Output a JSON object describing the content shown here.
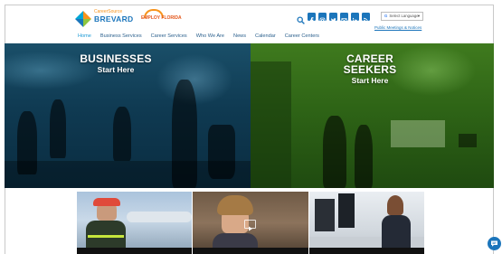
{
  "brand": {
    "logo_top": "CareerSource",
    "logo_name": "BREVARD",
    "partner_logo_text": "EMPLOY FLORIDA"
  },
  "header": {
    "social_icons": [
      "search-icon",
      "facebook-icon",
      "instagram-icon",
      "twitter-icon",
      "email-icon",
      "linkedin-icon",
      "rss-icon"
    ],
    "language_label": "Select Language",
    "public_link": "Public Meetings & Notices"
  },
  "nav": {
    "items": [
      "Home",
      "Business Services",
      "Career Services",
      "Who We Are",
      "News",
      "Calendar",
      "Career Centers"
    ],
    "active": "Home"
  },
  "hero": {
    "left_title": "BUSINESSES",
    "left_sub": "Start Here",
    "right_title": "CAREER SEEKERS",
    "right_sub": "Start Here"
  },
  "cards": [
    {
      "caption": ""
    },
    {
      "caption": ""
    },
    {
      "caption": ""
    }
  ],
  "colors": {
    "brand_blue": "#1b75bb",
    "nav_text": "#2a5f8c",
    "business_tint": "#0f3a52",
    "career_tint": "#2e6416"
  }
}
